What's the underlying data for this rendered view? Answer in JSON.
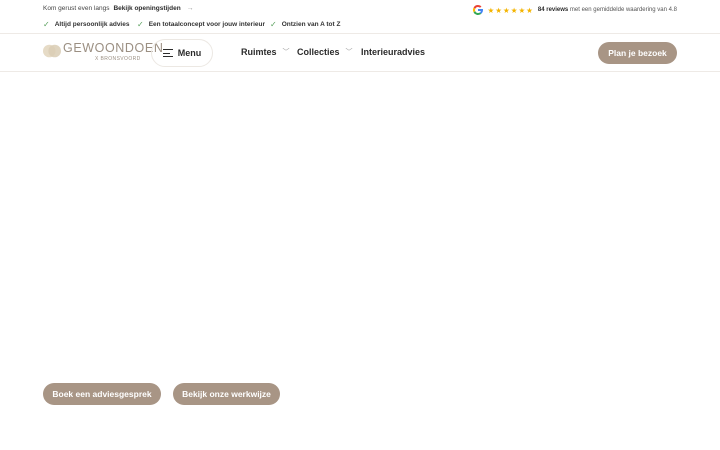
{
  "topbar": {
    "visit_text": "Kom gerust even langs",
    "hours_link": "Bekijk openingstijden",
    "hours_arrow_icon": "arrow-right-icon",
    "usps": [
      {
        "label": "Altijd persoonlijk advies"
      },
      {
        "label": "Een totaalconcept voor jouw interieur"
      },
      {
        "label": "Ontzien van A tot Z"
      }
    ],
    "check_icon": "check-icon",
    "check_color": "#58a05c",
    "reviews": {
      "icon": "google-g-icon",
      "stars": "★★★★★★",
      "star_color": "#f4b400",
      "count_text": "84 reviews",
      "rest_text": " met een gemiddelde waardering van 4.8"
    }
  },
  "header": {
    "logo_name": "GEWOONDOEN",
    "logo_sub": "X BRONSVOORD",
    "menu_label": "Menu",
    "nav": [
      {
        "label": "Ruimtes",
        "has_dropdown": true
      },
      {
        "label": "Collecties",
        "has_dropdown": true
      },
      {
        "label": "Interieuradvies",
        "has_dropdown": false
      }
    ],
    "plan_button": "Plan je bezoek"
  },
  "cta": {
    "primary": "Boek een adviesgesprek",
    "secondary": "Bekijk onze werkwijze"
  },
  "colors": {
    "accent": "#a89585",
    "logo": "#9b8f82",
    "border": "#eeeae6",
    "text": "#2b2b2b"
  }
}
